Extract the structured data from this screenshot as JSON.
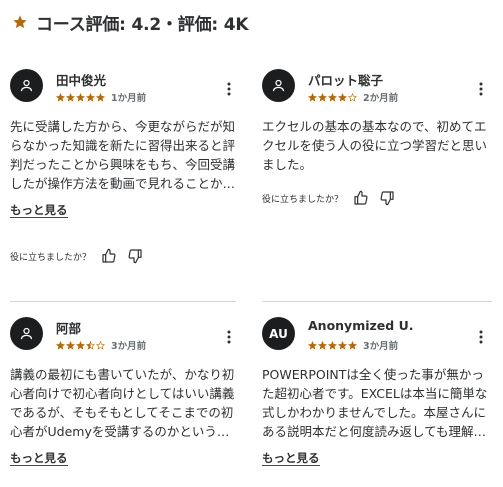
{
  "header": {
    "title": "コース評価: 4.2・評価: 4K"
  },
  "reviews": [
    {
      "name": "田中俊光",
      "avatar_initials": "",
      "avatar_icon": "user-icon",
      "rating": 5,
      "time": "1か月前",
      "body": "先に受講した方から、今更ながらだが知らなかった知識を新たに習得出来ると評判だったことから興味をもち、今回受講したが操作方法を動画で見れることから非常に分かり易く、リピートして学習したいと思いました。",
      "show_more": "もっと見る",
      "helpful": "役に立ちましたか？"
    },
    {
      "name": "パロット聡子",
      "avatar_initials": "",
      "avatar_icon": "user-icon",
      "rating": 4,
      "time": "2か月前",
      "body": "エクセルの基本の基本なので、初めてエクセルを使う人の役に立つ学習だと思いました。",
      "show_more": "",
      "helpful": "役に立ちましたか？"
    },
    {
      "name": "阿部",
      "avatar_initials": "",
      "avatar_icon": "user-icon",
      "rating": 3.5,
      "time": "3か月前",
      "body": "講義の最初にも書いていたが、かなり初心者向けで初心者向けとしてはいい講義であるが、そもそもとしてそこまでの初心者がUdemyを受講するのかという需要面を考えてどちらでもないといった評価になりました。",
      "show_more": "もっと見る",
      "helpful": ""
    },
    {
      "name": "Anonymized U.",
      "avatar_initials": "AU",
      "avatar_icon": "",
      "rating": 5,
      "time": "3か月前",
      "body": "POWERPOINTは全く使った事が無かった超初心者です。EXCELは本当に簡単な式しかわかりませんでした。本屋さんにある説明本だと何度読み返しても理解出来なかった物が今回、実際に操作しながら学ぶことができました。",
      "show_more": "もっと見る",
      "helpful": ""
    }
  ],
  "colors": {
    "star": "#b4690e",
    "avatar_bg": "#1c1d1f",
    "link_underline": "#5624d0",
    "divider": "#d1d7dc"
  }
}
